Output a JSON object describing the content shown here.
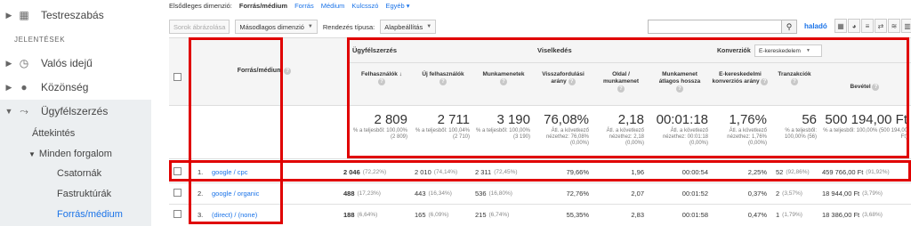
{
  "sidebar": {
    "top_item": "Testreszabás",
    "section": "JELENTÉSEK",
    "items": [
      "Valós idejű",
      "Közönség",
      "Ügyfélszerzés"
    ],
    "sub_items": [
      "Áttekintés",
      "Minden forgalom",
      "Csatornák",
      "Fastruktúrák",
      "Forrás/médium"
    ]
  },
  "dimension_bar": {
    "label": "Elsődleges dimenzió:",
    "active": "Forrás/médium",
    "links": [
      "Forrás",
      "Médium",
      "Kulcsszó",
      "Egyéb"
    ]
  },
  "toolbar": {
    "plot_rows": "Sorok ábrázolása",
    "secondary": "Másodlagos dimenzió",
    "sort_label": "Rendezés típusa:",
    "sort_value": "Alapbeállítás",
    "advanced": "haladó",
    "search_icon": "search-icon"
  },
  "table": {
    "dimension_header": "Forrás/médium",
    "groups": {
      "acquisition": "Ügyfélszerzés",
      "behavior": "Viselkedés",
      "conversions": "Konverziók",
      "conversion_select": "E-kereskedelem"
    },
    "columns": [
      "Felhasználók",
      "Új felhasználók",
      "Munkamenetek",
      "Visszafordulási arány",
      "Oldal / munkamenet",
      "Munkamenet átlagos hossza",
      "E-kereskedelmi konverziós arány",
      "Tranzakciók",
      "Bevétel"
    ],
    "totals": [
      {
        "value": "2 809",
        "sub": "% a teljesből: 100,00% (2 809)"
      },
      {
        "value": "2 711",
        "sub": "% a teljesből: 100,04% (2 710)"
      },
      {
        "value": "3 190",
        "sub": "% a teljesből: 100,00% (3 190)"
      },
      {
        "value": "76,08%",
        "sub": "Átl. a következő nézethez: 76,08% (0,00%)"
      },
      {
        "value": "2,18",
        "sub": "Átl. a következő nézethez: 2,18 (0,00%)"
      },
      {
        "value": "00:01:18",
        "sub": "Átl. a következő nézethez: 00:01:18 (0,00%)"
      },
      {
        "value": "1,76%",
        "sub": "Átl. a következő nézethez: 1,76% (0,00%)"
      },
      {
        "value": "56",
        "sub": "% a teljesből: 100,00% (56)"
      },
      {
        "value": "500 194,00 Ft",
        "sub": "% a teljesből: 100,00% (500 194,00 Ft)"
      }
    ],
    "rows": [
      {
        "idx": "1.",
        "source": "google / cpc",
        "users": "2 046",
        "users_pct": "(72,22%)",
        "new_users": "2 010",
        "new_pct": "(74,14%)",
        "sessions": "2 311",
        "sess_pct": "(72,45%)",
        "bounce": "79,66%",
        "pages": "1,96",
        "duration": "00:00:54",
        "conv": "2,25%",
        "trans": "52",
        "trans_pct": "(92,86%)",
        "revenue": "459 766,00 Ft",
        "rev_pct": "(91,92%)"
      },
      {
        "idx": "2.",
        "source": "google / organic",
        "users": "488",
        "users_pct": "(17,23%)",
        "new_users": "443",
        "new_pct": "(16,34%)",
        "sessions": "536",
        "sess_pct": "(16,80%)",
        "bounce": "72,76%",
        "pages": "2,07",
        "duration": "00:01:52",
        "conv": "0,37%",
        "trans": "2",
        "trans_pct": "(3,57%)",
        "revenue": "18 944,00 Ft",
        "rev_pct": "(3,79%)"
      },
      {
        "idx": "3.",
        "source": "(direct) / (none)",
        "users": "188",
        "users_pct": "(6,64%)",
        "new_users": "165",
        "new_pct": "(6,09%)",
        "sessions": "215",
        "sess_pct": "(6,74%)",
        "bounce": "55,35%",
        "pages": "2,83",
        "duration": "00:01:58",
        "conv": "0,47%",
        "trans": "1",
        "trans_pct": "(1,79%)",
        "revenue": "18 386,00 Ft",
        "rev_pct": "(3,68%)"
      }
    ]
  },
  "colors": {
    "annotation": "#e00000",
    "link": "#1a73e8",
    "active_band": "#eceff1"
  }
}
